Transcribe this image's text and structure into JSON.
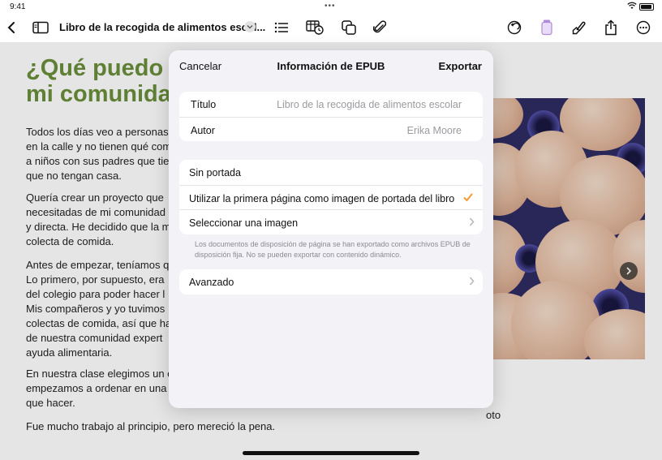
{
  "status_bar": {
    "time": "9:41"
  },
  "toolbar": {
    "doc_title": "Libro de la recogida de alimentos escol..."
  },
  "document": {
    "heading_line1": "¿Qué puedo",
    "heading_line2": "mi comunida",
    "paragraphs": [
      [
        "Todos los días veo a personas",
        "en la calle y no tienen qué com",
        "a niños con sus padres que tie",
        "que no tengan casa."
      ],
      [
        "Quería crear un proyecto que",
        "necesitadas de mi comunidad",
        "y directa. He decidido que la m",
        "colecta de comida."
      ],
      [
        "Antes de empezar, teníamos q",
        "Lo primero, por supuesto, era",
        "del colegio para poder hacer l",
        "Mis compañeros y yo tuvimos",
        "colectas de comida, así que ha",
        "de nuestra comunidad expert",
        "ayuda alimentaria."
      ],
      [
        "En nuestra clase elegimos un e",
        "empezamos a ordenar en una",
        "que hacer."
      ],
      [
        "Fue mucho trabajo al principio, pero mereció la pena."
      ]
    ],
    "photo_caption": "oto"
  },
  "sheet": {
    "cancel_label": "Cancelar",
    "title": "Información de EPUB",
    "export_label": "Exportar",
    "fields": [
      {
        "label": "Título",
        "value": "Libro de la recogida de alimentos escolar"
      },
      {
        "label": "Autor",
        "value": "Erika Moore"
      }
    ],
    "cover_options": [
      {
        "label": "Sin portada",
        "selected": false
      },
      {
        "label": "Utilizar la primera página como imagen de portada del libro",
        "selected": true
      },
      {
        "label": "Seleccionar una imagen",
        "selected": false
      }
    ],
    "footnote": "Los documentos de disposición de página se han exportado como archivos EPUB de disposición fija. No se pueden exportar con contenido dinámico.",
    "advanced_label": "Avanzado"
  },
  "colors": {
    "accent_check": "#f29b2f",
    "heading_green": "#6a8f3a"
  }
}
